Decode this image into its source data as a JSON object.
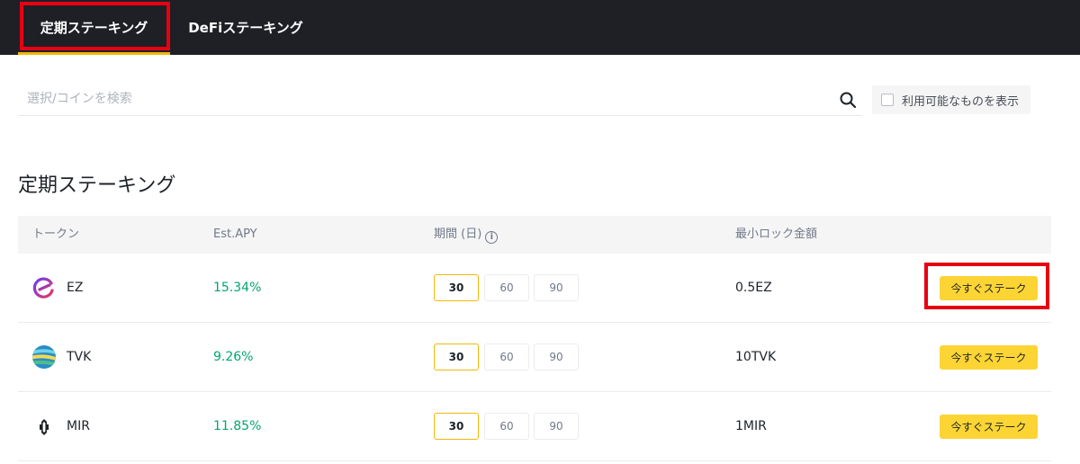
{
  "tabs": {
    "fixed_staking": "定期ステーキング",
    "defi_staking": "DeFiステーキング"
  },
  "search": {
    "placeholder": "選択/コインを検索",
    "icon": "search-icon"
  },
  "filter": {
    "show_available_label": "利用可能なものを表示",
    "checked": false
  },
  "section_title": "定期ステーキング",
  "table": {
    "headers": {
      "token": "トークン",
      "apy": "Est.APY",
      "duration": "期間 (日)",
      "min_lock": "最小ロック金額"
    },
    "rows": [
      {
        "token": "EZ",
        "apy": "15.34%",
        "durations": [
          "30",
          "60",
          "90"
        ],
        "selected_duration": "30",
        "min_lock": "0.5EZ",
        "action": "今すぐステーク"
      },
      {
        "token": "TVK",
        "apy": "9.26%",
        "durations": [
          "30",
          "60",
          "90"
        ],
        "selected_duration": "30",
        "min_lock": "10TVK",
        "action": "今すぐステーク"
      },
      {
        "token": "MIR",
        "apy": "11.85%",
        "durations": [
          "30",
          "60",
          "90"
        ],
        "selected_duration": "30",
        "min_lock": "1MIR",
        "action": "今すぐステーク"
      }
    ]
  },
  "colors": {
    "topbar": "#1e2026",
    "accent": "#f0b90b",
    "button": "#fcd535",
    "positive": "#03a66d",
    "highlight_box": "#e60012"
  }
}
